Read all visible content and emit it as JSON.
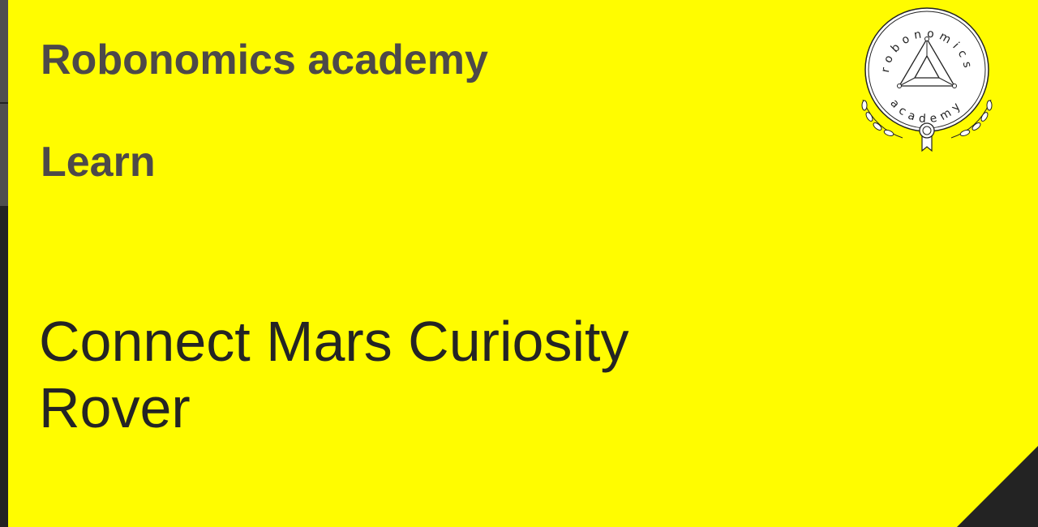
{
  "header": {
    "brand": "Robonomics academy",
    "section": "Learn"
  },
  "slide": {
    "title_line1": "Connect Mars Curiosity",
    "title_line2": "Rover"
  },
  "logo": {
    "icon": "robonomics-academy-badge-icon",
    "ring_text_top": "robonomics",
    "ring_text_bottom": "academy"
  },
  "colors": {
    "background": "#fffc00",
    "heading": "#4d4949",
    "title": "#242424",
    "accent_dark": "#232323"
  }
}
